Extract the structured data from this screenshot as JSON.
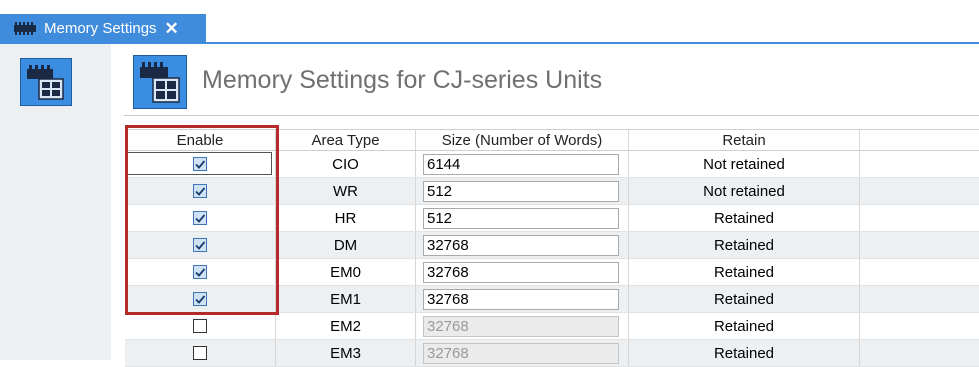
{
  "tab": {
    "label": "Memory Settings",
    "close_glyph": "✕",
    "icon": "memory-chip-icon"
  },
  "header": {
    "title": "Memory Settings for CJ-series Units",
    "icon": "memory-unit-icon"
  },
  "left_panel": {
    "icon": "memory-unit-icon"
  },
  "colors": {
    "accent": "#3f8bdc",
    "highlight": "#b52a2a",
    "alt_row": "#edf0f3"
  },
  "table": {
    "columns": [
      "Enable",
      "Area Type",
      "Size (Number of Words)",
      "Retain"
    ],
    "rows": [
      {
        "enabled": true,
        "area": "CIO",
        "size": "6144",
        "retain": "Not retained",
        "editable": true
      },
      {
        "enabled": true,
        "area": "WR",
        "size": "512",
        "retain": "Not retained",
        "editable": true
      },
      {
        "enabled": true,
        "area": "HR",
        "size": "512",
        "retain": "Retained",
        "editable": true
      },
      {
        "enabled": true,
        "area": "DM",
        "size": "32768",
        "retain": "Retained",
        "editable": true
      },
      {
        "enabled": true,
        "area": "EM0",
        "size": "32768",
        "retain": "Retained",
        "editable": true
      },
      {
        "enabled": true,
        "area": "EM1",
        "size": "32768",
        "retain": "Retained",
        "editable": true
      },
      {
        "enabled": false,
        "area": "EM2",
        "size": "32768",
        "retain": "Retained",
        "editable": false
      },
      {
        "enabled": false,
        "area": "EM3",
        "size": "32768",
        "retain": "Retained",
        "editable": false
      }
    ]
  }
}
